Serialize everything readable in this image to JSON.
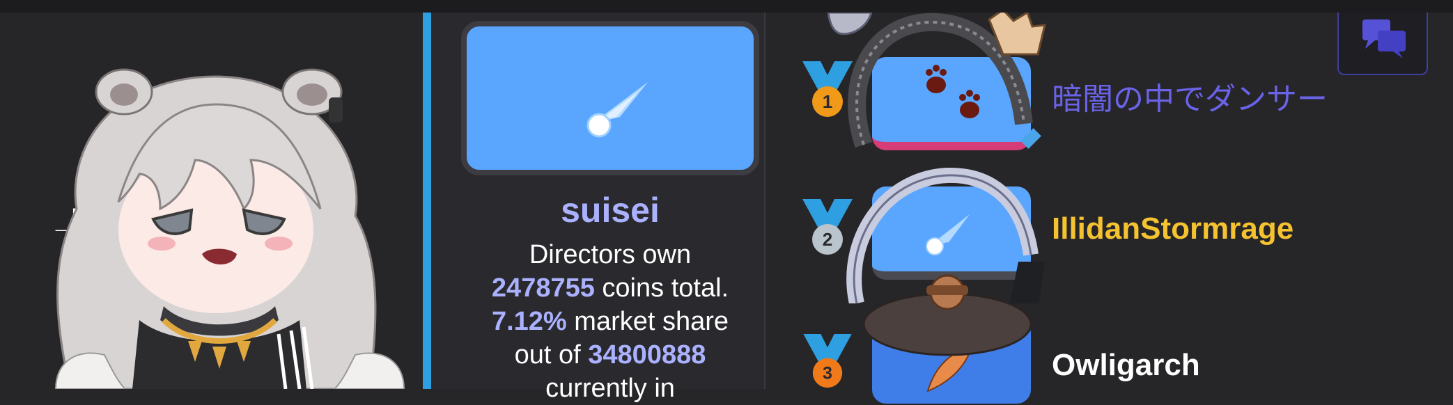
{
  "profile": {
    "name": "suisei",
    "line1": "Directors own",
    "coins_total": "2478755",
    "coins_suffix": "coins total.",
    "market_share": "7.12%",
    "market_suffix": "market share",
    "out_of": "out of",
    "total_supply": "34800888",
    "currently_in": "currently in"
  },
  "leaderboard": [
    {
      "rank": "1",
      "name": "暗闇の中でダンサー",
      "color": "#6a63e8",
      "medal": "#f19a1a"
    },
    {
      "rank": "2",
      "name": "IllidanStormrage",
      "color": "#f5c230",
      "medal": "#b9c4cc"
    },
    {
      "rank": "3",
      "name": "Owligarch",
      "color": "#ffffff",
      "medal": "#f07a1a"
    }
  ],
  "left_partial_text": "_I",
  "icons": {
    "chat": "chat-bubbles-icon",
    "comet": "comet-icon",
    "paw": "paw-icon",
    "feather": "feather-icon"
  },
  "colors": {
    "accent": "#2e9fe0",
    "card_blue": "#5aa6ff",
    "highlight": "#aab2ff"
  }
}
